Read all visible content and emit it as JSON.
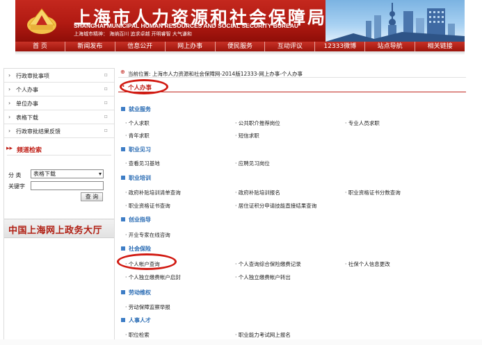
{
  "header": {
    "title_cn": "上海市人力资源和社会保障局",
    "title_en": "SHANGHAI MUNICIPAL HUMAN RESOURCES AND SOCIAL SECURITY BUREAU",
    "spirit": "上海城市精神：  海纳百川    追求卓越    开明睿智    大气谦和"
  },
  "nav": [
    "首  页",
    "新闻发布",
    "信息公开",
    "网上办事",
    "便民服务",
    "互动评议",
    "12333微博",
    "站点导航",
    "相关链接"
  ],
  "sidebar": {
    "items": [
      "行政审批事项",
      "个人办事",
      "单位办事",
      "表格下载",
      "行政审批结果反馈"
    ],
    "search_title": "频道检索",
    "category_label": "分  类",
    "category_value": "表格下载",
    "keyword_label": "关键字",
    "query_button": "查 询",
    "gov_banner": "中国上海网上政务大厅"
  },
  "main": {
    "breadcrumb": "当前位置: 上海市人力资源和社会保障网-2014版12333-网上办事-个人办事",
    "section_title": "个人办事",
    "categories": [
      {
        "name": "就业服务",
        "links": [
          "· 个人求职",
          "· 公共职介推荐岗位",
          "· 专业人员求职",
          "· 青年求职",
          "· 短信求职"
        ]
      },
      {
        "name": "职业见习",
        "links": [
          "· 查看见习基地",
          "· 应聘见习岗位"
        ]
      },
      {
        "name": "职业培训",
        "links": [
          "· 政府补贴培训清单查询",
          "· 政府补贴培训报名",
          "· 职业资格证书分数查询",
          "· 职业资格证书查询",
          "· 居住证积分申请技能直接结果查询"
        ]
      },
      {
        "name": "创业指导",
        "links": [
          "· 开业专家在线咨询"
        ]
      },
      {
        "name": "社会保险",
        "links": [
          "· 个人帐户查询",
          "· 个人查询综合保险缴费记录",
          "· 社保个人信息更改",
          "· 个人独立缴费帐户启封",
          "· 个人独立缴费帐户转出"
        ]
      },
      {
        "name": "劳动维权",
        "links": [
          "· 劳动保障监察举报"
        ]
      },
      {
        "name": "人事人才",
        "links": [
          "· 职位检索",
          "· 职业能力考试网上报名"
        ]
      }
    ]
  },
  "colors": {
    "brand_red": "#c0221a",
    "category_blue": "#2a6cb4",
    "highlight_ring": "#d11a12"
  }
}
